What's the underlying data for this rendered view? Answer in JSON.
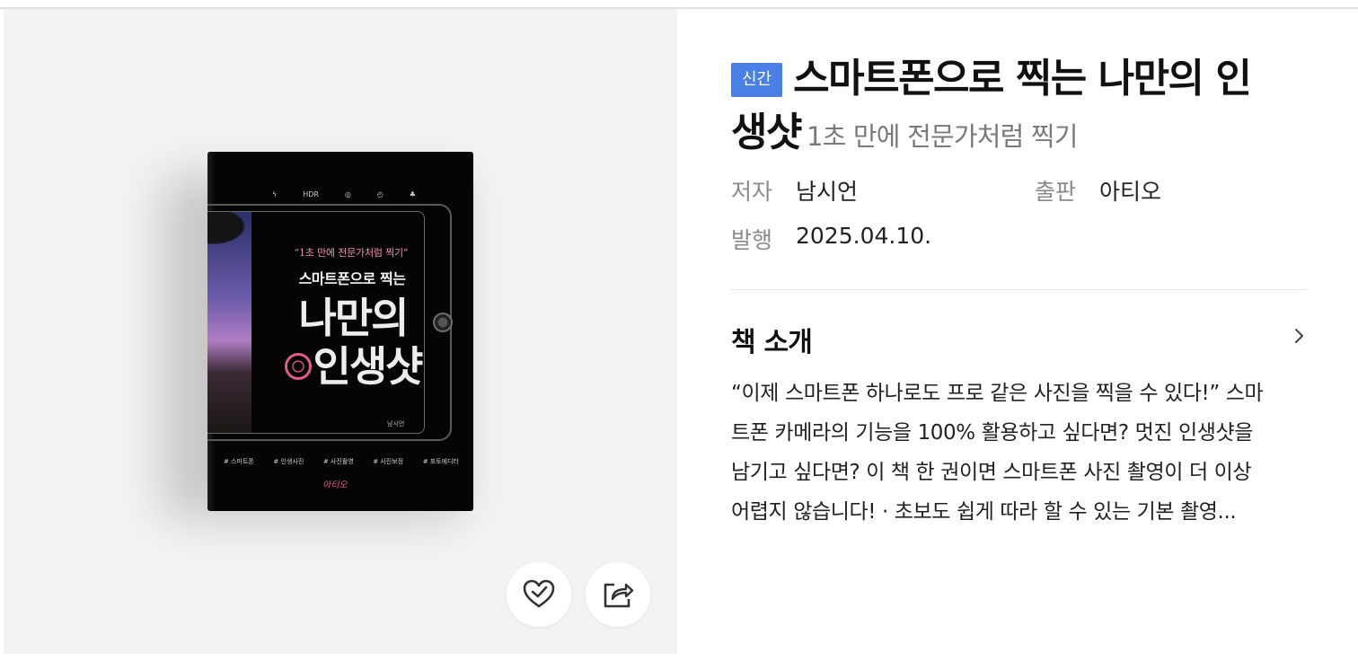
{
  "cover": {
    "quote": "“1초 만에 전문가처럼 찍기”",
    "subtitle": "스마트폰으로 찍는",
    "title_line1": "나만의",
    "title_line2": "인생샷",
    "author": "남시언",
    "tags": [
      "# 스마트폰",
      "# 인생사진",
      "# 사진촬영",
      "# 사진보정",
      "# 포토에디터"
    ],
    "publisher_logo": "아티오",
    "camera_icons": [
      "ϟ",
      "HDR",
      "◎",
      "◴",
      "♣"
    ]
  },
  "actions": {
    "like_icon": "heart-check-icon",
    "share_icon": "share-icon"
  },
  "book": {
    "badge": "신간",
    "title": "스마트폰으로 찍는 나만의 인생샷",
    "title_line1": "스마트폰으로 찍는 나만의 인",
    "title_line2": "생샷",
    "subtitle": "1초 만에 전문가처럼 찍기",
    "author_label": "저자",
    "author": "남시언",
    "publisher_label": "출판",
    "publisher": "아티오",
    "date_label": "발행",
    "date": "2025.04.10."
  },
  "intro": {
    "heading": "책 소개",
    "lines": [
      "“이제 스마트폰 하나로도 프로 같은 사진을 찍을 수 있다!” 스마",
      "트폰 카메라의 기능을 100% 활용하고 싶다면? 멋진 인생샷을",
      "남기고 싶다면? 이 책 한 권이면 스마트폰 사진 촬영이 더 이상",
      "어렵지 않습니다!  ·  초보도 쉽게 따라 할 수 있는 기본 촬영..."
    ]
  }
}
